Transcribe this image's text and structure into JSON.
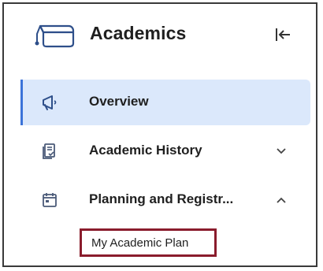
{
  "header": {
    "title": "Academics",
    "icon": "graduation-cap-icon",
    "collapse_icon": "collapse-left-icon"
  },
  "nav": {
    "items": [
      {
        "label": "Overview",
        "icon": "megaphone-icon",
        "active": true
      },
      {
        "label": "Academic History",
        "icon": "document-check-icon",
        "expanded": false
      },
      {
        "label": "Planning and Registr...",
        "icon": "calendar-icon",
        "expanded": true
      }
    ],
    "subitems": [
      {
        "label": "My Academic Plan",
        "highlighted": true
      }
    ]
  },
  "colors": {
    "active_bg": "#dbe8fb",
    "active_border": "#3b73d9",
    "highlight_border": "#8a1c2c",
    "text": "#1f1f1f",
    "icon": "#4a5a78"
  }
}
